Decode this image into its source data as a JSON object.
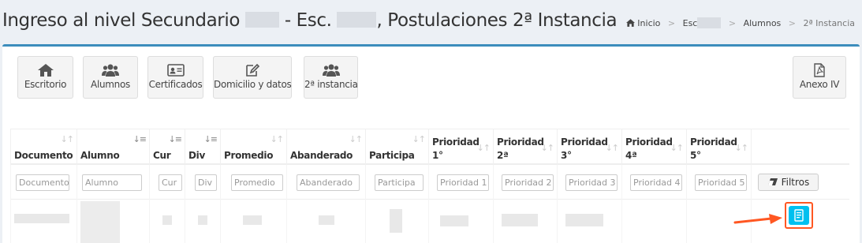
{
  "header": {
    "title_part1": "Ingreso al nivel Secundario",
    "title_part2": "- Esc.",
    "title_part3": ", Postulaciones 2ª Instancia"
  },
  "breadcrumb": {
    "items": [
      "Inicio",
      "Esc",
      "Alumnos",
      "2ª Instancia"
    ]
  },
  "toolbar": {
    "buttons": [
      {
        "label": "Escritorio",
        "icon": "home-icon"
      },
      {
        "label": "Alumnos",
        "icon": "users-icon"
      },
      {
        "label": "Certificados",
        "icon": "id-card-icon"
      },
      {
        "label": "Domicilio y datos",
        "icon": "edit-icon"
      },
      {
        "label": "2ª instancia",
        "icon": "users-icon"
      }
    ],
    "right_button": {
      "label": "Anexo IV",
      "icon": "pdf-file-icon"
    }
  },
  "table": {
    "columns": [
      {
        "line1": "Documento",
        "line2": ""
      },
      {
        "line1": "Alumno",
        "line2": ""
      },
      {
        "line1": "Cur",
        "line2": ""
      },
      {
        "line1": "Div",
        "line2": ""
      },
      {
        "line1": "Promedio",
        "line2": ""
      },
      {
        "line1": "Abanderado",
        "line2": ""
      },
      {
        "line1": "Participa",
        "line2": ""
      },
      {
        "line1": "Prioridad",
        "line2": "1°"
      },
      {
        "line1": "Prioridad",
        "line2": "2ª"
      },
      {
        "line1": "Prioridad",
        "line2": "3°"
      },
      {
        "line1": "Prioridad",
        "line2": "4ª"
      },
      {
        "line1": "Prioridad",
        "line2": "5°"
      }
    ],
    "filter_placeholders": [
      "Documento",
      "Alumno",
      "Cur",
      "Div",
      "Promedio",
      "Abanderado",
      "Participa",
      "Prioridad 1",
      "Prioridad 2",
      "Prioridad 3",
      "Prioridad 4",
      "Prioridad 5"
    ],
    "filter_button_label": "Filtros",
    "action_icon": "document-icon"
  },
  "colors": {
    "accent": "#3c8dbc",
    "action_button": "#00c0ef",
    "highlight": "#ff5722"
  }
}
